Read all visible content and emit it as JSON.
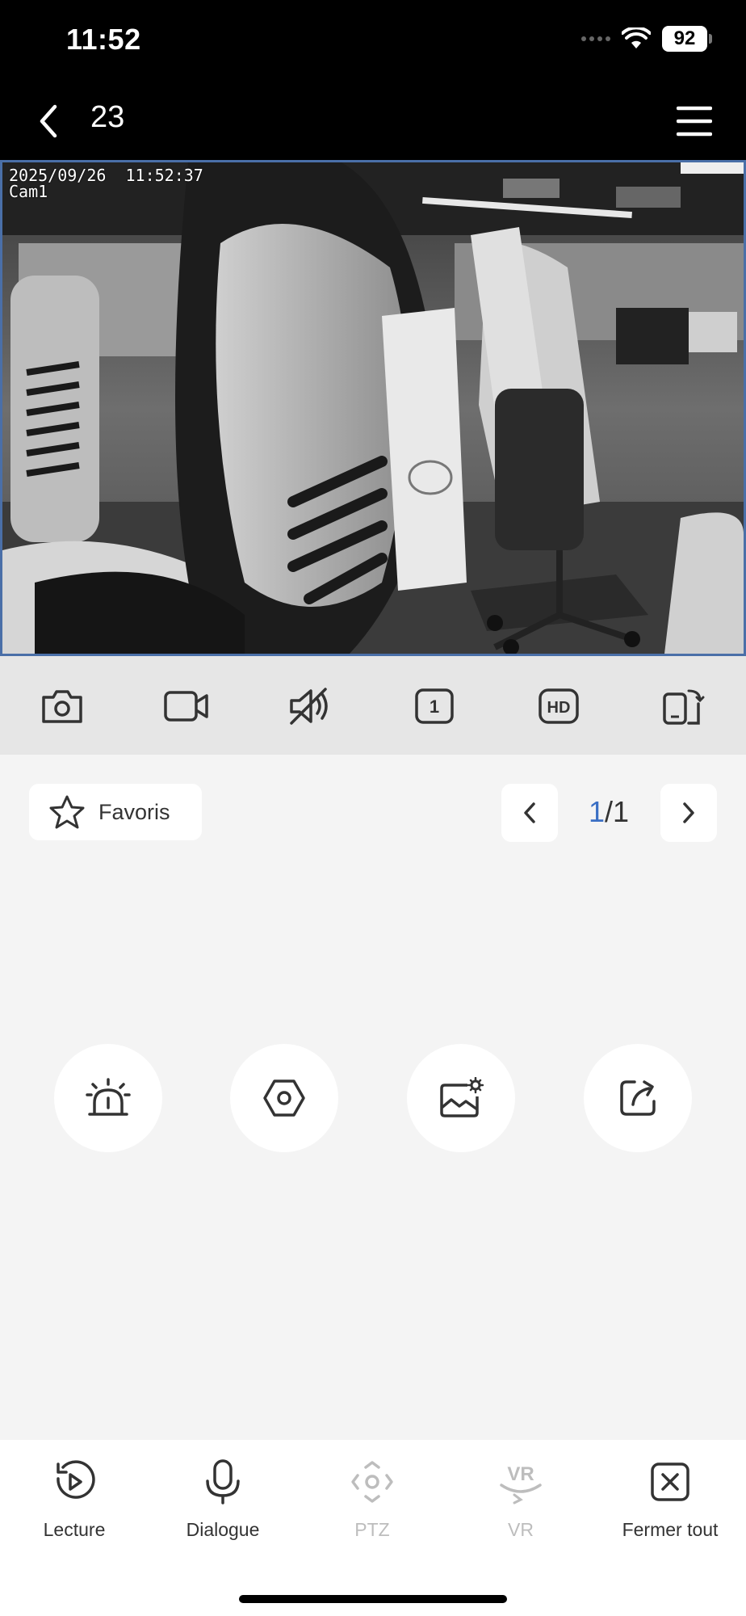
{
  "status_bar": {
    "time": "11:52",
    "battery": "92"
  },
  "nav": {
    "title": "23"
  },
  "video": {
    "timestamp": "2025/09/26  11:52:37",
    "camera_name": "Cam1"
  },
  "toolbar": {
    "icons": [
      "camera-icon",
      "video-record-icon",
      "mute-icon",
      "channel-1-icon",
      "hd-icon",
      "screen-switch-icon"
    ],
    "channel_label": "1",
    "hd_label": "HD"
  },
  "favorites": {
    "label": "Favoris"
  },
  "pagination": {
    "current": "1",
    "separator": "/",
    "total": "1"
  },
  "actions": [
    "alarm-siren-icon",
    "hexagon-settings-icon",
    "image-settings-icon",
    "share-icon"
  ],
  "bottom_nav": {
    "items": [
      {
        "label": "Lecture",
        "icon": "playback-icon",
        "enabled": true
      },
      {
        "label": "Dialogue",
        "icon": "microphone-icon",
        "enabled": true
      },
      {
        "label": "PTZ",
        "icon": "ptz-icon",
        "enabled": false
      },
      {
        "label": "VR",
        "icon": "vr-icon",
        "enabled": false
      },
      {
        "label": "Fermer tout",
        "icon": "close-all-icon",
        "enabled": true
      }
    ],
    "vr_icon_text": "VR"
  },
  "colors": {
    "accent": "#3a6fc4",
    "video_border": "#4a6fa8",
    "disabled": "#bdbdbd"
  }
}
